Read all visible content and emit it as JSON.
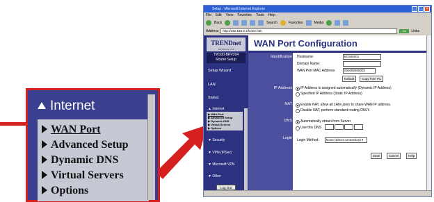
{
  "browser": {
    "title": "Setup - Microsoft Internet Explorer",
    "menu": [
      "File",
      "Edit",
      "View",
      "Favorites",
      "Tools",
      "Help"
    ],
    "toolbar": {
      "back": "Back",
      "search": "Search",
      "favorites": "Favorites",
      "media": "Media"
    },
    "address_label": "Address",
    "address": "http://192.168.0.1/home.htm",
    "go": "Go",
    "links": "Links"
  },
  "inset": {
    "header": "Internet",
    "items": [
      {
        "label": "WAN Port",
        "active": true
      },
      {
        "label": "Advanced Setup"
      },
      {
        "label": "Dynamic DNS"
      },
      {
        "label": "Virtual Servers"
      },
      {
        "label": "Options"
      }
    ]
  },
  "sidebar": {
    "logo": "TRENDnet",
    "logo_sub": "TRENDware, USA",
    "model": "TW100-BRV204",
    "model_sub": "Router Setup",
    "setup_wizard": "Setup Wizard",
    "lan": "LAN",
    "status": "Status",
    "internet": "Internet",
    "internet_items": [
      "WAN Port",
      "Advanced Setup",
      "Dynamic DNS",
      "Virtual Servers",
      "Options"
    ],
    "security": "Security",
    "vpn": "VPN (IPSec)",
    "microsoft_vpn": "Microsoft VPN",
    "other": "Other",
    "logout": "Log Out"
  },
  "page": {
    "title": "WAN Port Configuration",
    "identification_label": "Identification",
    "hostname_label": "Hostname:",
    "hostname_value": "BC505001",
    "domain_label": "Domain Name:",
    "domain_value": "",
    "mac_label": "WAN Port MAC Address:",
    "mac_value": "00e082505002",
    "default_btn": "Default",
    "copy_btn": "Copy from PC",
    "ip_label": "IP Address",
    "ip_auto": "IP Address is assigned automatically (Dynamic IP Address)",
    "ip_static": "Specified IP Address (Static IP Address)",
    "nat_label": "NAT",
    "nat_enable": "Enable NAT, allow all LAN users to share WAN IP address.",
    "nat_disable": "Disable NAT, perform standard routing ONLY.",
    "dns_label": "DNS",
    "dns_auto": "Automatically obtain from Server",
    "dns_use": "Use this DNS",
    "login_label": "Login",
    "login_method_label": "Login Method:",
    "login_method_value": "None (Direct connection)",
    "save_btn": "Save",
    "cancel_btn": "Cancel",
    "help_btn": "Help"
  },
  "colors": {
    "accent": "#2c3180",
    "arrow": "#d62020"
  }
}
